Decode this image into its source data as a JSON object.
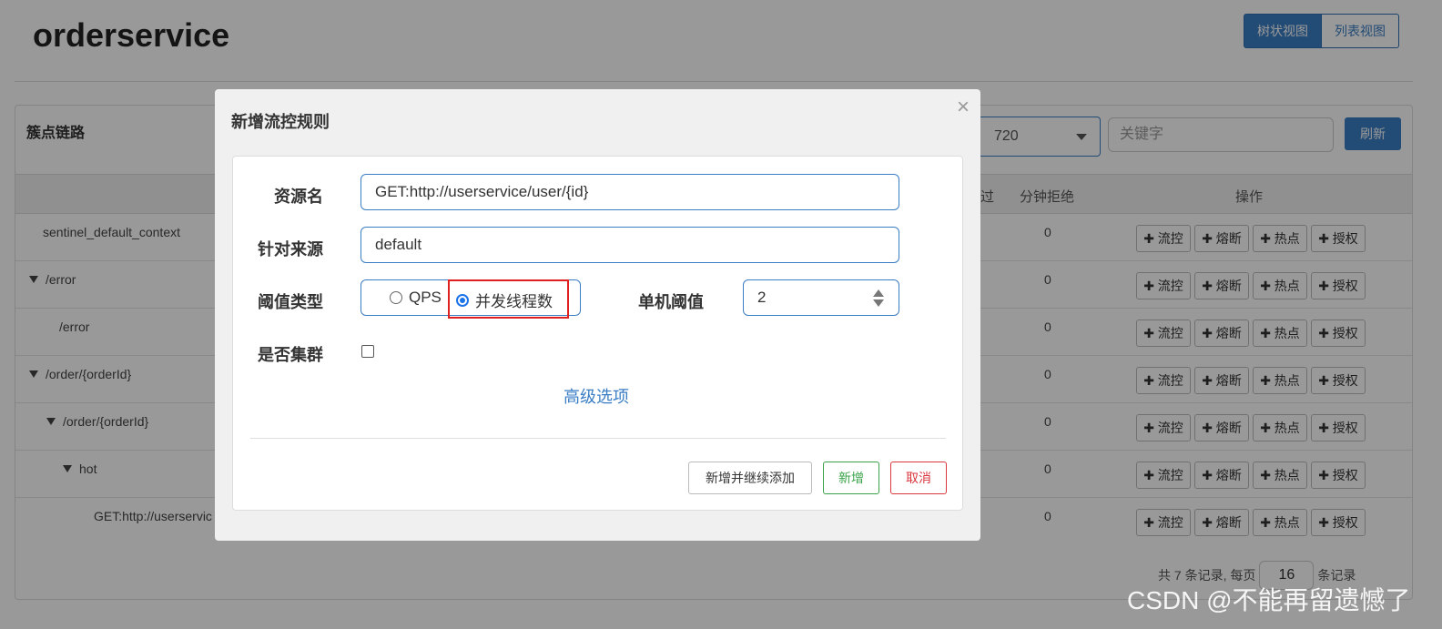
{
  "page": {
    "title": "orderservice",
    "view_tree": "树状视图",
    "view_list": "列表视图"
  },
  "panel": {
    "heading": "簇点链路",
    "machine_select": "720",
    "keyword_placeholder": "关键字",
    "refresh": "刷新",
    "columns": {
      "pass": "过",
      "reject": "分钟拒绝",
      "ops": "操作"
    },
    "rows": [
      {
        "name": "sentinel_default_context",
        "value": "0"
      },
      {
        "name": "/error",
        "value": "0"
      },
      {
        "name": "/error",
        "value": "0"
      },
      {
        "name": "/order/{orderId}",
        "value": "0"
      },
      {
        "name": "/order/{orderId}",
        "value": "0"
      },
      {
        "name": "hot",
        "value": "0"
      },
      {
        "name": "GET:http://userservic",
        "value": "0"
      }
    ],
    "op_labels": {
      "flow": "✚ 流控",
      "degrade": "✚ 熔断",
      "hot": "✚ 热点",
      "auth": "✚ 授权"
    },
    "pager": {
      "total_prefix": "共 7 条记录, 每页",
      "page_size": "16",
      "suffix": "条记录"
    }
  },
  "modal": {
    "title": "新增流控规则",
    "close": "×",
    "resource_label": "资源名",
    "resource_value": "GET:http://userservice/user/{id}",
    "origin_label": "针对来源",
    "origin_value": "default",
    "threshold_type_label": "阈值类型",
    "option_qps": "QPS",
    "option_threads": "并发线程数",
    "single_threshold_label": "单机阈值",
    "single_threshold_value": "2",
    "cluster_label": "是否集群",
    "advanced": "高级选项",
    "btn_continue": "新增并继续添加",
    "btn_add": "新增",
    "btn_cancel": "取消"
  },
  "watermark": "CSDN @不能再留遗憾了"
}
